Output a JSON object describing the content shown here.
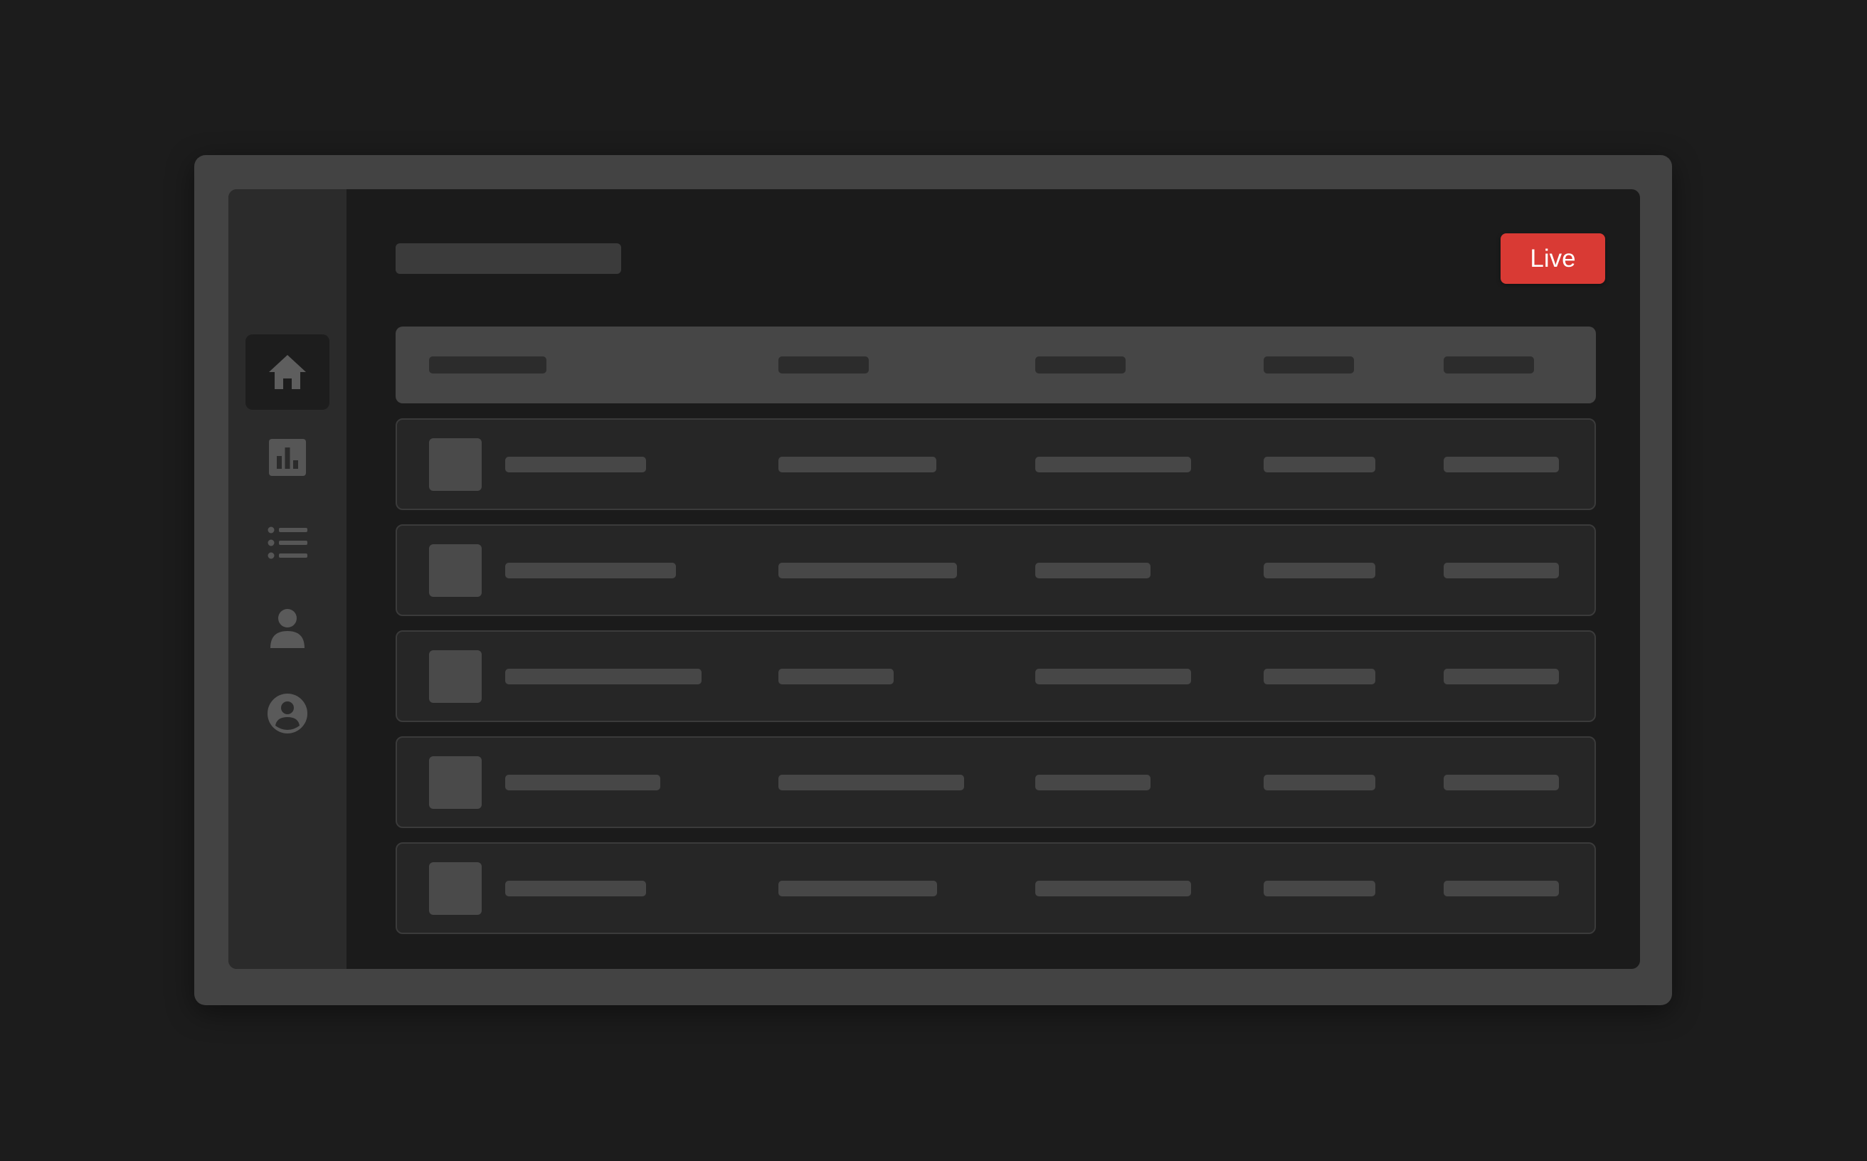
{
  "header": {
    "live_label": "Live"
  },
  "sidebar": {
    "items": [
      {
        "icon": "home-icon",
        "active": true
      },
      {
        "icon": "bar-chart-icon",
        "active": false
      },
      {
        "icon": "list-icon",
        "active": false
      },
      {
        "icon": "user-icon",
        "active": false
      },
      {
        "icon": "account-circle-icon",
        "active": false
      }
    ]
  },
  "table": {
    "column_count": 5,
    "row_count": 5
  },
  "colors": {
    "background": "#1c1c1c",
    "bezel": "#434343",
    "screen": "#1b1b1b",
    "sidebar": "#2b2b2b",
    "table_header": "#464646",
    "row": "#262626",
    "skeleton": "#474747",
    "accent_live": "#d93a34",
    "icon": "#5a5a5a"
  }
}
